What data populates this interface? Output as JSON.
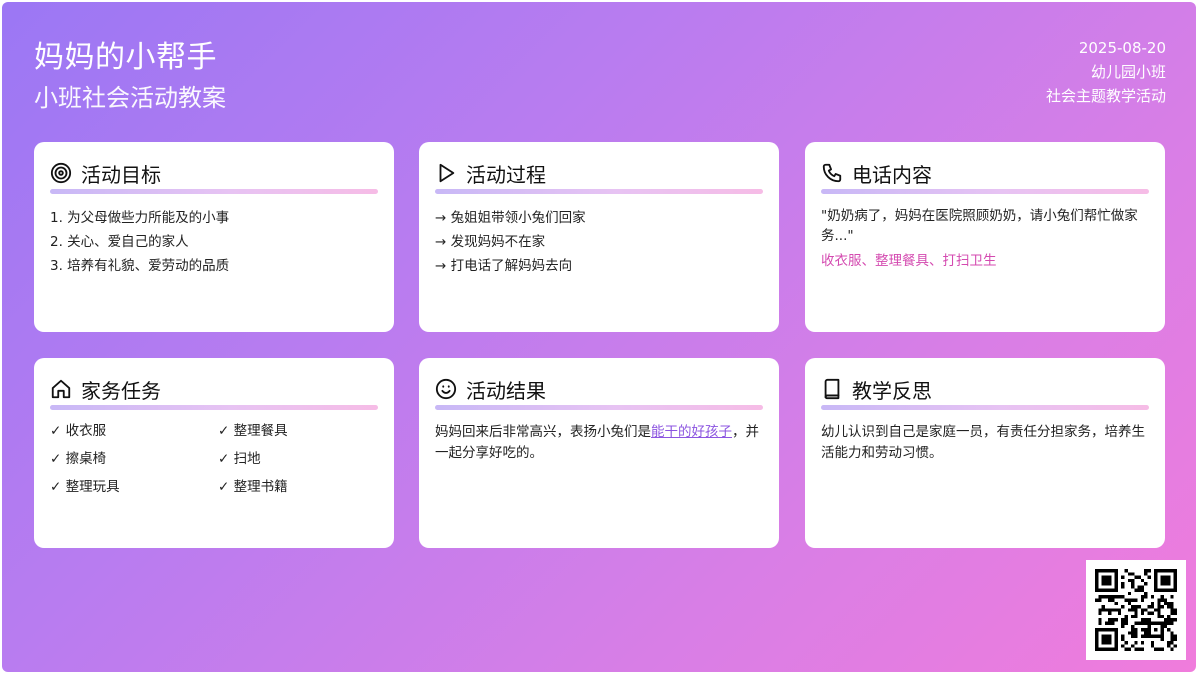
{
  "header": {
    "title": "妈妈的小帮手",
    "subtitle": "小班社会活动教案",
    "date": "2025-08-20",
    "class_name": "幼儿园小班",
    "theme": "社会主题教学活动"
  },
  "cards": {
    "goals": {
      "title": "活动目标",
      "icon": "target-icon",
      "items": [
        "1. 为父母做些力所能及的小事",
        "2. 关心、爱自己的家人",
        "3. 培养有礼貌、爱劳动的品质"
      ]
    },
    "process": {
      "title": "活动过程",
      "icon": "play-icon",
      "items": [
        "→ 兔姐姐带领小兔们回家",
        "→ 发现妈妈不在家",
        "→ 打电话了解妈妈去向"
      ]
    },
    "phone": {
      "title": "电话内容",
      "icon": "phone-icon",
      "quote": "\"奶奶病了，妈妈在医院照顾奶奶，请小兔们帮忙做家务...\"",
      "chores": "收衣服、整理餐具、打扫卫生"
    },
    "tasks": {
      "title": "家务任务",
      "icon": "home-icon",
      "items": [
        "✓ 收衣服",
        "✓ 整理餐具",
        "✓ 擦桌椅",
        "✓ 扫地",
        "✓ 整理玩具",
        "✓ 整理书籍"
      ]
    },
    "result": {
      "title": "活动结果",
      "icon": "smile-icon",
      "text_before": "妈妈回来后非常高兴，表扬小兔们是",
      "highlight": "能干的好孩子",
      "text_after": "，并一起分享好吃的。"
    },
    "reflection": {
      "title": "教学反思",
      "icon": "book-icon",
      "text": "幼儿认识到自己是家庭一员，有责任分担家务，培养生活能力和劳动习惯。"
    }
  },
  "colors": {
    "gradient_start": "#9b77f4",
    "gradient_end": "#f07cdc",
    "accent_pink": "#d44ab0",
    "link_purple": "#8c55e0"
  }
}
